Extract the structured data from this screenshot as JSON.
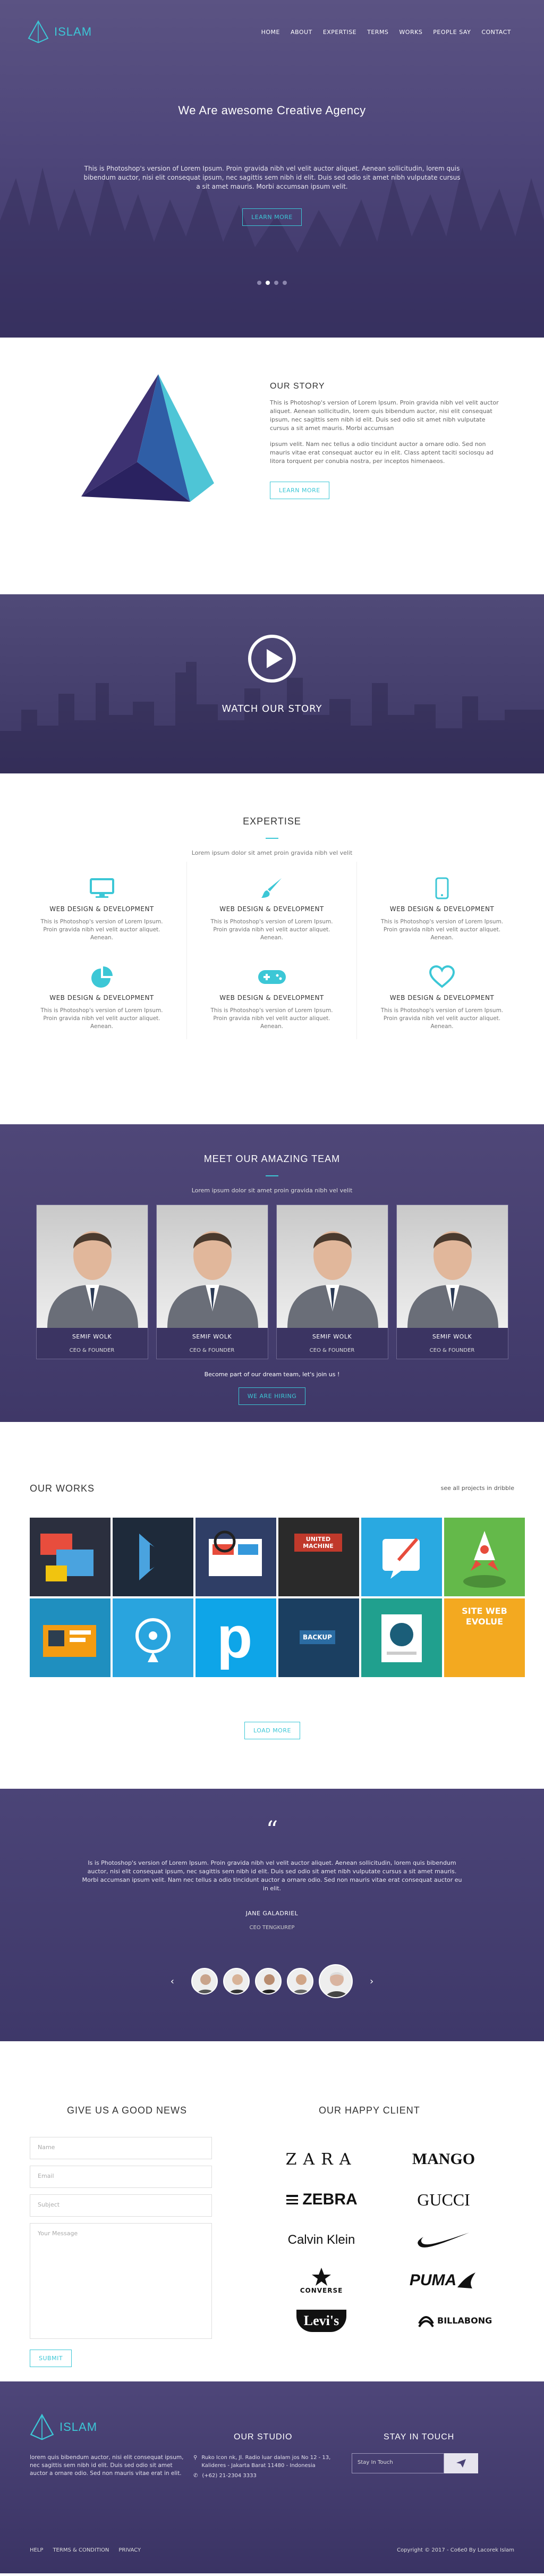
{
  "brand": {
    "name": "ISLAM",
    "accent": "#3cc7d6",
    "bg_purple": "#4d457a"
  },
  "nav": {
    "items": [
      "HOME",
      "ABOUT",
      "EXPERTISE",
      "TERMS",
      "WORKS",
      "PEOPLE SAY",
      "CONTACT"
    ]
  },
  "hero": {
    "title": "We Are awesome Creative Agency",
    "text": "This is Photoshop's version of Lorem Ipsum. Proin gravida nibh vel velit auctor aliquet. Aenean sollicitudin, lorem quis bibendum auctor, nisi elit consequat ipsum, nec sagittis sem nibh id elit. Duis sed odio sit amet nibh vulputate cursus a sit amet mauris. Morbi accumsan ipsum velit.",
    "button": "LEARN MORE",
    "slides": 4,
    "active_slide": 2
  },
  "story": {
    "title": "OUR STORY",
    "p1": "This is Photoshop's version of Lorem Ipsum. Proin gravida nibh vel velit auctor aliquet. Aenean sollicitudin, lorem quis bibendum auctor, nisi elit consequat ipsum, nec sagittis sem nibh id elit. Duis sed odio sit amet nibh vulputate cursus a sit amet mauris. Morbi accumsan",
    "p2": "ipsum velit. Nam nec tellus a odio tincidunt auctor a ornare odio. Sed non mauris vitae erat consequat auctor eu in elit. Class aptent taciti sociosqu ad litora torquent per conubia nostra, per inceptos himenaeos.",
    "button": "LEARN MORE"
  },
  "video": {
    "title": "WATCH OUR STORY"
  },
  "expertise": {
    "title": "EXPERTISE",
    "subtitle": "Lorem ipsum dolor sit amet proin gravida nibh vel velit",
    "items": [
      {
        "icon": "monitor-icon",
        "title": "WEB DESIGN & DEVELOPMENT",
        "text": "This is Photoshop's version of Lorem Ipsum. Proin gravida nibh vel velit auctor aliquet. Aenean."
      },
      {
        "icon": "brush-icon",
        "title": "WEB DESIGN & DEVELOPMENT",
        "text": "This is Photoshop's version of Lorem Ipsum. Proin gravida nibh vel velit auctor aliquet. Aenean."
      },
      {
        "icon": "phone-icon",
        "title": "WEB DESIGN & DEVELOPMENT",
        "text": "This is Photoshop's version of Lorem Ipsum. Proin gravida nibh vel velit auctor aliquet. Aenean."
      },
      {
        "icon": "pie-chart-icon",
        "title": "WEB DESIGN & DEVELOPMENT",
        "text": "This is Photoshop's version of Lorem Ipsum. Proin gravida nibh vel velit auctor aliquet. Aenean."
      },
      {
        "icon": "gamepad-icon",
        "title": "WEB DESIGN & DEVELOPMENT",
        "text": "This is Photoshop's version of Lorem Ipsum. Proin gravida nibh vel velit auctor aliquet. Aenean."
      },
      {
        "icon": "heart-icon",
        "title": "WEB DESIGN & DEVELOPMENT",
        "text": "This is Photoshop's version of Lorem Ipsum. Proin gravida nibh vel velit auctor aliquet. Aenean."
      }
    ]
  },
  "team": {
    "title": "MEET OUR AMAZING TEAM",
    "subtitle": "Lorem ipsum dolor sit amet proin gravida nibh vel velit",
    "members": [
      {
        "name": "SEMIF WOLK",
        "role": "CEO & FOUNDER"
      },
      {
        "name": "SEMIF WOLK",
        "role": "CEO & FOUNDER"
      },
      {
        "name": "SEMIF WOLK",
        "role": "CEO & FOUNDER"
      },
      {
        "name": "SEMIF WOLK",
        "role": "CEO & FOUNDER"
      }
    ],
    "join": "Become part of our dream team, let's join us !",
    "button": "WE ARE HIRING"
  },
  "works": {
    "title": "OUR WORKS",
    "see_all": "see all projects in dribble",
    "button": "LOAD MORE",
    "thumbs": [
      {
        "label": "",
        "bg": "#2b2f3e"
      },
      {
        "label": "",
        "bg": "#1e2a3a"
      },
      {
        "label": "",
        "bg": "#2f3e66"
      },
      {
        "label": "UNITED MACHINE",
        "bg": "#2a2a2a"
      },
      {
        "label": "",
        "bg": "#29a9e1"
      },
      {
        "label": "",
        "bg": "#64b94a"
      },
      {
        "label": "",
        "bg": "#1f8fbf"
      },
      {
        "label": "",
        "bg": "#29a4de"
      },
      {
        "label": "p",
        "bg": "#0ea5e8"
      },
      {
        "label": "BACKUP",
        "bg": "#1b3f61"
      },
      {
        "label": "",
        "bg": "#20a08e"
      },
      {
        "label": "SITE WEB EVOLUE",
        "bg": "#f3a920"
      }
    ]
  },
  "testimonial": {
    "quote_mark": "“",
    "text": "Is is Photoshop's version of Lorem Ipsum. Proin gravida nibh vel velit auctor aliquet. Aenean sollicitudin, lorem quis bibendum auctor, nisi elit consequat ipsum, nec sagittis sem nibh id elit. Duis sed odio sit amet nibh vulputate cursus a sit amet mauris. Morbi accumsan ipsum velit. Nam nec tellus a odio tincidunt auctor a ornare odio. Sed non mauris vitae erat consequat auctor eu in elit.",
    "name": "JANE GALADRIEL",
    "position": "CEO TENGKUREP",
    "prev": "‹",
    "next": "›"
  },
  "contact": {
    "title": "GIVE US A GOOD NEWS",
    "name_placeholder": "Name",
    "email_placeholder": "Email",
    "subject_placeholder": "Subject",
    "message_placeholder": "Your Message",
    "button": "SUBMIT"
  },
  "clients": {
    "title": "OUR HAPPY CLIENT",
    "logos": [
      "ZARA",
      "MANGO",
      "ZEBRA",
      "GUCCI",
      "Calvin Klein",
      "NIKE",
      "CONVERSE",
      "PUMA",
      "Levi's",
      "BILLABONG"
    ]
  },
  "footer": {
    "about": "lorem quis bibendum auctor, nisi elit consequat ipsum, nec sagittis sem nibh id elit. Duis sed odio sit amet auctor a ornare odio. Sed non mauris vitae erat in elit.",
    "studio_title": "OUR STUDIO",
    "address": "Ruko Icon nk, Jl. Radio luar dalam jos No 12 - 13, Kalideres - Jakarta Barat 11480 - Indonesia",
    "phone": "(+62) 21-2304 3333",
    "touch_title": "STAY IN TOUCH",
    "subscribe_placeholder": "Stay In Touch",
    "links": [
      "HELP",
      "TERMS & CONDITION",
      "PRIVACY"
    ],
    "copyright": "Copyright © 2017 - Co6e0 By Lacorek Islam"
  }
}
